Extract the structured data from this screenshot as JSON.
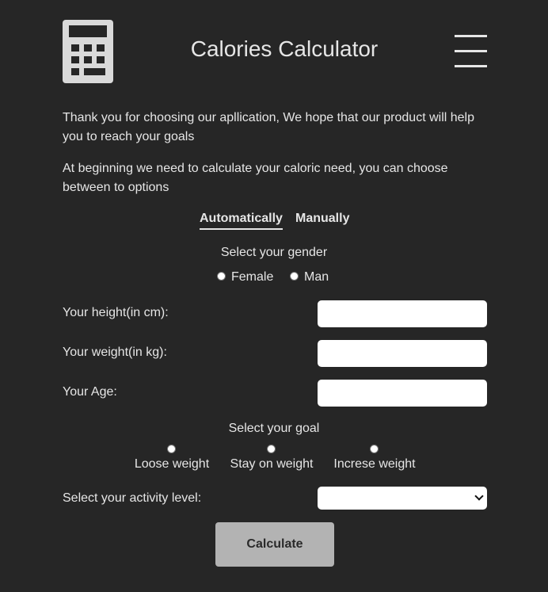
{
  "header": {
    "title": "Calories Calculator",
    "logo_icon": "calculator-icon",
    "menu_icon": "hamburger-menu-icon"
  },
  "intro": {
    "paragraph1": "Thank you for choosing our apllication, We hope that our product will help you to reach your goals",
    "paragraph2": "At beginning we need to calculate your caloric need, you can choose between to options"
  },
  "tabs": [
    {
      "label": "Automatically",
      "active": true
    },
    {
      "label": "Manually",
      "active": false
    }
  ],
  "gender": {
    "title": "Select your gender",
    "options": [
      "Female",
      "Man"
    ]
  },
  "fields": {
    "height_label": "Your height(in cm):",
    "height_value": "",
    "weight_label": "Your weight(in kg):",
    "weight_value": "",
    "age_label": "Your Age:",
    "age_value": ""
  },
  "goal": {
    "title": "Select your goal",
    "options": [
      "Loose weight",
      "Stay on weight",
      "Increse weight"
    ]
  },
  "activity": {
    "label": "Select your activity level:",
    "selected": ""
  },
  "calculate_label": "Calculate",
  "colors": {
    "background": "#262626",
    "text": "#e6e6e6",
    "button": "#b3b3b3"
  }
}
